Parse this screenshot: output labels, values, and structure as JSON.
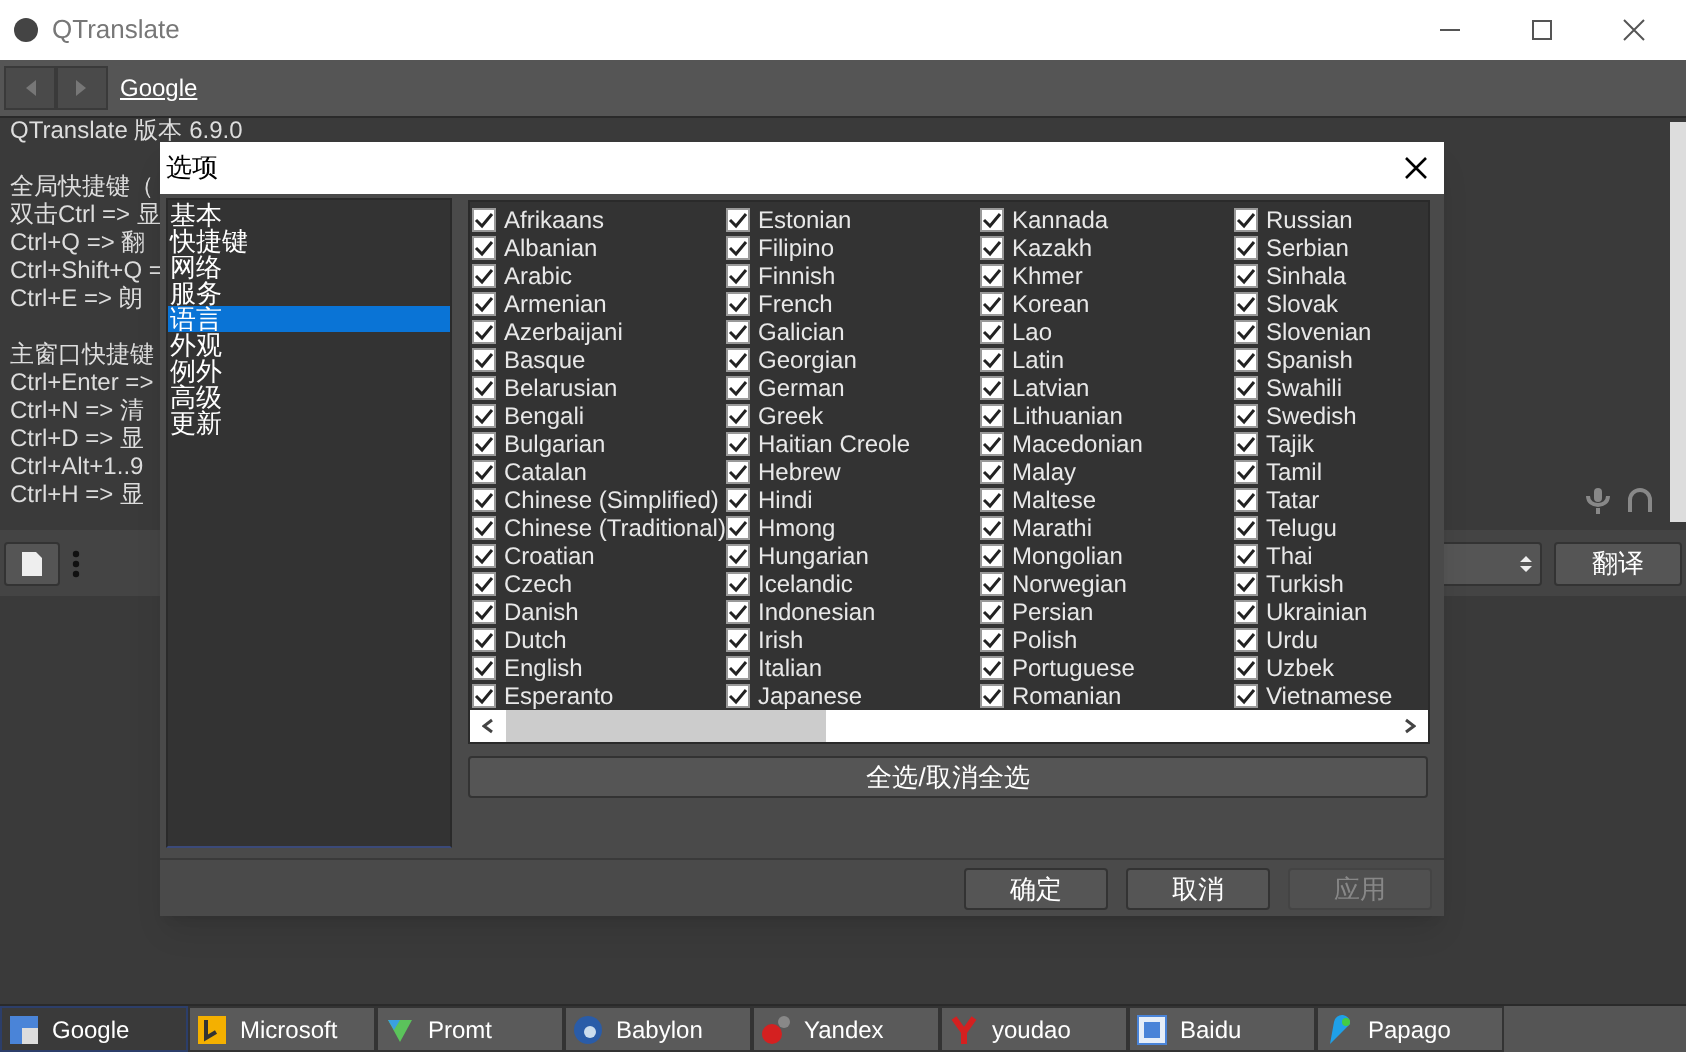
{
  "window": {
    "title": "QTranslate"
  },
  "toolbar": {
    "service_link": "Google"
  },
  "background_text": [
    [
      "QTranslate 版本 6.9.0"
    ],
    [
      "全局快捷键（",
      "双击Ctrl => 显",
      "Ctrl+Q => 翻",
      "Ctrl+Shift+Q =",
      "Ctrl+E => 朗"
    ],
    [
      "主窗口快捷键",
      "Ctrl+Enter =>",
      "Ctrl+N => 清",
      "Ctrl+D => 显",
      "Ctrl+Alt+1..9",
      "Ctrl+H => 显"
    ]
  ],
  "translate_button": "翻译",
  "dialog": {
    "title": "选项",
    "categories": [
      {
        "label": "基本",
        "selected": false
      },
      {
        "label": "快捷键",
        "selected": false
      },
      {
        "label": "网络",
        "selected": false
      },
      {
        "label": "服务",
        "selected": false
      },
      {
        "label": "语言",
        "selected": true
      },
      {
        "label": "外观",
        "selected": false
      },
      {
        "label": "例外",
        "selected": false
      },
      {
        "label": "高级",
        "selected": false
      },
      {
        "label": "更新",
        "selected": false
      }
    ],
    "languages": [
      {
        "label": "Afrikaans",
        "checked": true
      },
      {
        "label": "Albanian",
        "checked": true
      },
      {
        "label": "Arabic",
        "checked": true
      },
      {
        "label": "Armenian",
        "checked": true
      },
      {
        "label": "Azerbaijani",
        "checked": true
      },
      {
        "label": "Basque",
        "checked": true
      },
      {
        "label": "Belarusian",
        "checked": true
      },
      {
        "label": "Bengali",
        "checked": true
      },
      {
        "label": "Bulgarian",
        "checked": true
      },
      {
        "label": "Catalan",
        "checked": true
      },
      {
        "label": "Chinese (Simplified)",
        "checked": true
      },
      {
        "label": "Chinese (Traditional)",
        "checked": true
      },
      {
        "label": "Croatian",
        "checked": true
      },
      {
        "label": "Czech",
        "checked": true
      },
      {
        "label": "Danish",
        "checked": true
      },
      {
        "label": "Dutch",
        "checked": true
      },
      {
        "label": "English",
        "checked": true
      },
      {
        "label": "Esperanto",
        "checked": true
      },
      {
        "label": "Estonian",
        "checked": true
      },
      {
        "label": "Filipino",
        "checked": true
      },
      {
        "label": "Finnish",
        "checked": true
      },
      {
        "label": "French",
        "checked": true
      },
      {
        "label": "Galician",
        "checked": true
      },
      {
        "label": "Georgian",
        "checked": true
      },
      {
        "label": "German",
        "checked": true
      },
      {
        "label": "Greek",
        "checked": true
      },
      {
        "label": "Haitian Creole",
        "checked": true
      },
      {
        "label": "Hebrew",
        "checked": true
      },
      {
        "label": "Hindi",
        "checked": true
      },
      {
        "label": "Hmong",
        "checked": true
      },
      {
        "label": "Hungarian",
        "checked": true
      },
      {
        "label": "Icelandic",
        "checked": true
      },
      {
        "label": "Indonesian",
        "checked": true
      },
      {
        "label": "Irish",
        "checked": true
      },
      {
        "label": "Italian",
        "checked": true
      },
      {
        "label": "Japanese",
        "checked": true
      },
      {
        "label": "Kannada",
        "checked": true
      },
      {
        "label": "Kazakh",
        "checked": true
      },
      {
        "label": "Khmer",
        "checked": true
      },
      {
        "label": "Korean",
        "checked": true
      },
      {
        "label": "Lao",
        "checked": true
      },
      {
        "label": "Latin",
        "checked": true
      },
      {
        "label": "Latvian",
        "checked": true
      },
      {
        "label": "Lithuanian",
        "checked": true
      },
      {
        "label": "Macedonian",
        "checked": true
      },
      {
        "label": "Malay",
        "checked": true
      },
      {
        "label": "Maltese",
        "checked": true
      },
      {
        "label": "Marathi",
        "checked": true
      },
      {
        "label": "Mongolian",
        "checked": true
      },
      {
        "label": "Norwegian",
        "checked": true
      },
      {
        "label": "Persian",
        "checked": true
      },
      {
        "label": "Polish",
        "checked": true
      },
      {
        "label": "Portuguese",
        "checked": true
      },
      {
        "label": "Romanian",
        "checked": true
      },
      {
        "label": "Russian",
        "checked": true
      },
      {
        "label": "Serbian",
        "checked": true
      },
      {
        "label": "Sinhala",
        "checked": true
      },
      {
        "label": "Slovak",
        "checked": true
      },
      {
        "label": "Slovenian",
        "checked": true
      },
      {
        "label": "Spanish",
        "checked": true
      },
      {
        "label": "Swahili",
        "checked": true
      },
      {
        "label": "Swedish",
        "checked": true
      },
      {
        "label": "Tajik",
        "checked": true
      },
      {
        "label": "Tamil",
        "checked": true
      },
      {
        "label": "Tatar",
        "checked": true
      },
      {
        "label": "Telugu",
        "checked": true
      },
      {
        "label": "Thai",
        "checked": true
      },
      {
        "label": "Turkish",
        "checked": true
      },
      {
        "label": "Ukrainian",
        "checked": true
      },
      {
        "label": "Urdu",
        "checked": true
      },
      {
        "label": "Uzbek",
        "checked": true
      },
      {
        "label": "Vietnamese",
        "checked": true
      }
    ],
    "toggle_all_button": "全选/取消全选",
    "buttons": [
      {
        "label": "确定",
        "disabled": false
      },
      {
        "label": "取消",
        "disabled": false
      },
      {
        "label": "应用",
        "disabled": true
      }
    ]
  },
  "services": [
    {
      "label": "Google",
      "selected": true
    },
    {
      "label": "Microsoft",
      "selected": false
    },
    {
      "label": "Promt",
      "selected": false
    },
    {
      "label": "Babylon",
      "selected": false
    },
    {
      "label": "Yandex",
      "selected": false
    },
    {
      "label": "youdao",
      "selected": false
    },
    {
      "label": "Baidu",
      "selected": false
    },
    {
      "label": "Papago",
      "selected": false
    }
  ]
}
